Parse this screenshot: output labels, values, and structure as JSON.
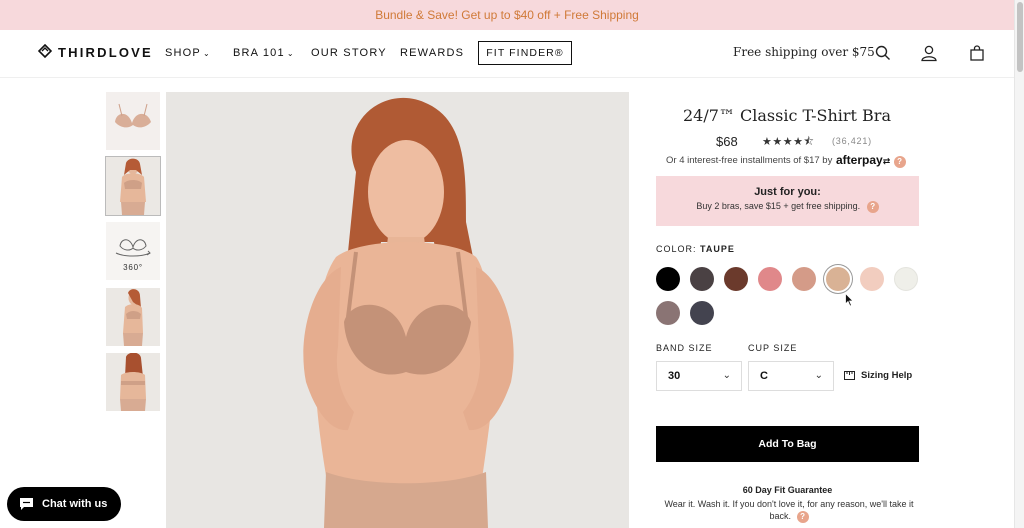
{
  "promo": {
    "text": "Bundle & Save! Get up to $40 off + Free Shipping"
  },
  "header": {
    "logo_text": "THIRDLOVE",
    "nav": [
      {
        "label": "SHOP",
        "has_dropdown": true
      },
      {
        "label": "BRA 101",
        "has_dropdown": true
      },
      {
        "label": "OUR STORY",
        "has_dropdown": false
      },
      {
        "label": "REWARDS",
        "has_dropdown": false
      }
    ],
    "dropdown_glyph": "⌄",
    "fit_finder_label": "FIT FINDER®",
    "shipping_text": "Free shipping over $75",
    "icons": [
      "search-icon",
      "account-icon",
      "bag-icon"
    ]
  },
  "gallery": {
    "thumbnails": [
      {
        "name": "bra-product-thumb"
      },
      {
        "name": "model-front-thumb",
        "active": true
      },
      {
        "name": "360-view-thumb",
        "label": "360°"
      },
      {
        "name": "model-side-thumb"
      },
      {
        "name": "model-back-thumb"
      }
    ]
  },
  "product": {
    "title": "24/7™ Classic T-Shirt Bra",
    "price": "$68",
    "rating": 4.5,
    "stars_text": "★★★★⯪",
    "reviews": "(36,421)",
    "installments": "Or 4 interest-free installments of $17 by",
    "afterpay_brand": "afterpay",
    "question_glyph": "?",
    "offer": {
      "title": "Just for you:",
      "subtitle": "Buy 2 bras, save $15 + get free shipping."
    },
    "color_label": "COLOR:",
    "color_selected": "TAUPE",
    "swatches": [
      {
        "color": "#000000"
      },
      {
        "color": "#4a4143"
      },
      {
        "color": "#6b3a2c"
      },
      {
        "color": "#e0888a"
      },
      {
        "color": "#d49b88"
      },
      {
        "color": "#d9b295",
        "selected": true
      },
      {
        "color": "#f2cdbf"
      },
      {
        "color": "#efefe9"
      },
      {
        "color": "#8a7474"
      },
      {
        "color": "#43434f"
      }
    ],
    "band_label": "BAND SIZE",
    "band_value": "30",
    "cup_label": "CUP SIZE",
    "cup_value": "C",
    "select_chevron": "⌄",
    "sizing_help": "Sizing Help",
    "add_to_bag": "Add To Bag",
    "guarantee_title": "60 Day Fit Guarantee",
    "guarantee_text": "Wear it. Wash it. If you don't love it, for any reason, we'll take it back."
  },
  "chat": {
    "label": "Chat with us"
  }
}
